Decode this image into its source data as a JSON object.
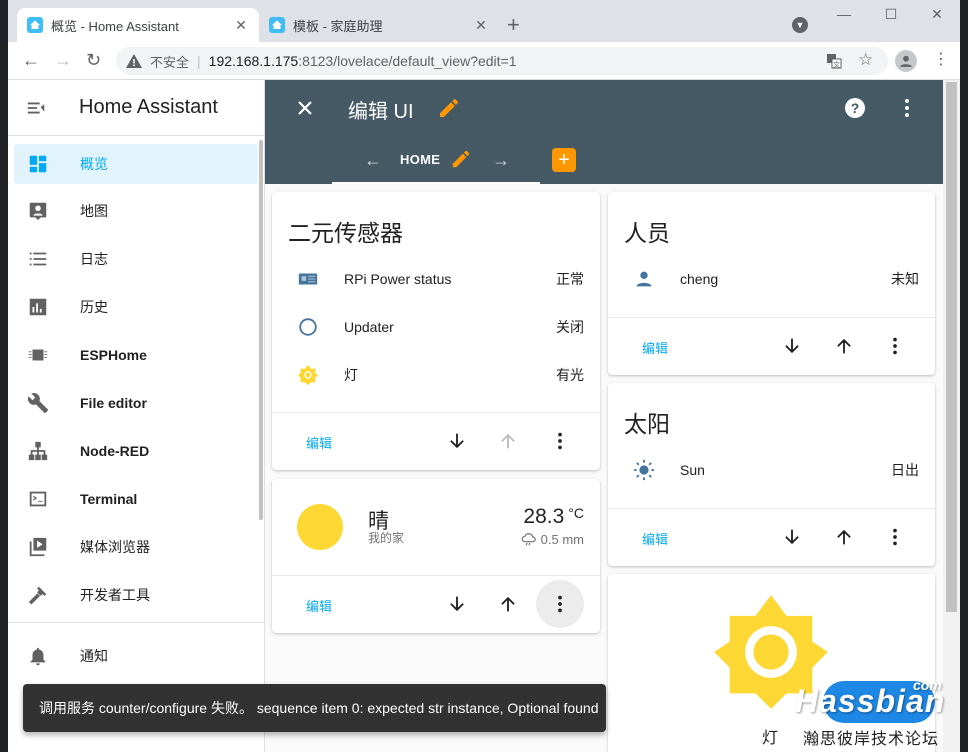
{
  "browser": {
    "tabs": [
      {
        "title": "概览 - Home Assistant",
        "active": true
      },
      {
        "title": "模板 - 家庭助理",
        "active": false
      }
    ],
    "window_controls": {
      "minimize": "—",
      "maximize": "☐",
      "close": "✕"
    },
    "not_secure": "不安全",
    "url_host": "192.168.1.175",
    "url_rest": ":8123/lovelace/default_view?edit=1"
  },
  "sidebar": {
    "title": "Home Assistant",
    "items": [
      {
        "label": "概览",
        "icon": "dashboard-icon",
        "selected": true
      },
      {
        "label": "地图",
        "icon": "map-account-icon"
      },
      {
        "label": "日志",
        "icon": "logbook-icon"
      },
      {
        "label": "历史",
        "icon": "history-chart-icon"
      },
      {
        "label": "ESPHome",
        "icon": "chip-icon"
      },
      {
        "label": "File editor",
        "icon": "wrench-icon"
      },
      {
        "label": "Node-RED",
        "icon": "sitemap-icon"
      },
      {
        "label": "Terminal",
        "icon": "console-icon"
      },
      {
        "label": "媒体浏览器",
        "icon": "play-box-icon"
      },
      {
        "label": "开发者工具",
        "icon": "hammer-icon"
      },
      {
        "label": "通知",
        "icon": "bell-icon"
      }
    ]
  },
  "header": {
    "title": "编辑 UI",
    "view_name": "HOME",
    "add_view": "+"
  },
  "cards": {
    "binary": {
      "title": "二元传感器",
      "rows": [
        {
          "name": "RPi Power status",
          "state": "正常",
          "icon": "raspberry-pi-icon"
        },
        {
          "name": "Updater",
          "state": "关闭",
          "icon": "checkbox-blank-circle-outline-icon"
        },
        {
          "name": "灯",
          "state": "有光",
          "icon": "brightness-icon"
        }
      ],
      "edit": "编辑"
    },
    "weather": {
      "condition": "晴",
      "location": "我的家",
      "temperature": "28.3",
      "unit": "°C",
      "precipitation": "0.5 mm",
      "edit": "编辑"
    },
    "person": {
      "title": "人员",
      "rows": [
        {
          "name": "cheng",
          "state": "未知",
          "icon": "account-icon"
        }
      ],
      "edit": "编辑"
    },
    "sun": {
      "title": "太阳",
      "rows": [
        {
          "name": "Sun",
          "state": "日出",
          "icon": "sun-icon"
        }
      ],
      "edit": "编辑"
    },
    "light": {
      "name": "灯"
    }
  },
  "snackbar": {
    "message": "调用服务 counter/configure 失败。 sequence item 0: expected str instance, Optional found"
  },
  "watermark": {
    "brand": "Hassbian",
    "suffix": "com",
    "tagline": "瀚思彼岸技术论坛"
  },
  "colors": {
    "header": "#455a64",
    "accent": "#03a9f4",
    "orange": "#ff9800",
    "state_icon": "#44739e",
    "sun_yellow": "#fdd835"
  }
}
